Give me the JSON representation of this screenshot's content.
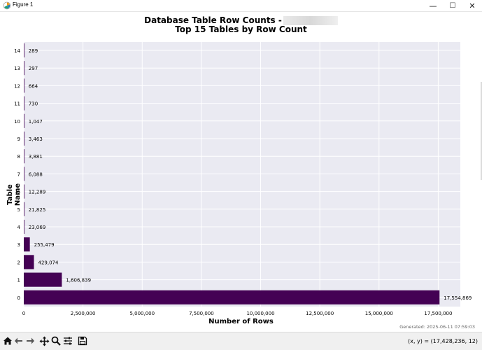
{
  "window": {
    "title": "Figure 1",
    "minimize": "—",
    "maximize": "☐",
    "close": "✕"
  },
  "chart_data": {
    "type": "bar",
    "orientation": "horizontal",
    "title_line1": "Database Table Row Counts -",
    "title_line2": "Top 15 Tables by Row Count",
    "xlabel": "Number of Rows",
    "ylabel": "Table Name",
    "categories": [
      "0",
      "1",
      "2",
      "3",
      "4",
      "5",
      "6",
      "7",
      "8",
      "9",
      "10",
      "11",
      "12",
      "13",
      "14"
    ],
    "values": [
      17554869,
      1606839,
      429074,
      255479,
      23069,
      21825,
      12289,
      6088,
      3881,
      3463,
      1047,
      730,
      664,
      297,
      289
    ],
    "value_labels": [
      "17,554,869",
      "1,606,839",
      "429,074",
      "255,479",
      "23,069",
      "21,825",
      "12,289",
      "6,088",
      "3,881",
      "3,463",
      "1,047",
      "730",
      "664",
      "297",
      "289"
    ],
    "xticks": [
      0,
      2500000,
      5000000,
      7500000,
      10000000,
      12500000,
      15000000,
      17500000
    ],
    "xtick_labels": [
      "0",
      "2,500,000",
      "5,000,000",
      "7,500,000",
      "10,000,000",
      "12,500,000",
      "15,000,000",
      "17,500,000"
    ],
    "xlim": [
      0,
      18432612
    ],
    "grid": true,
    "bar_color": "#440154",
    "background": "#eaeaf2"
  },
  "footer": {
    "generated": "Generated: 2025-06-11 07:59:03"
  },
  "toolbar": {
    "coords": "(x, y) = (17,428,236, 12)"
  }
}
